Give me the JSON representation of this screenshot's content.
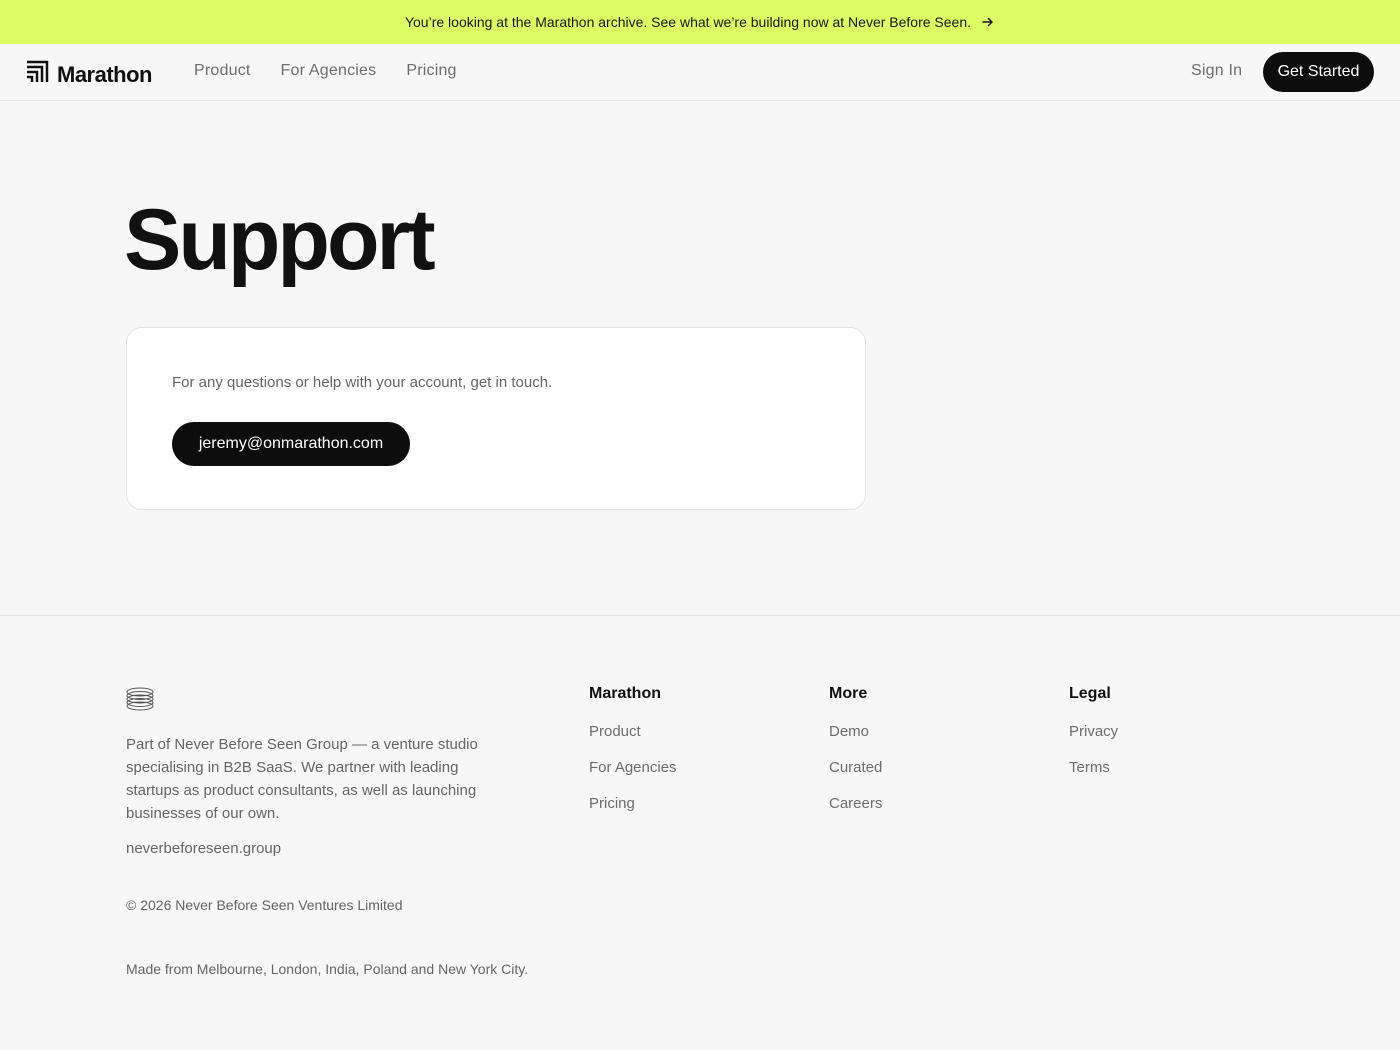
{
  "banner": {
    "text": "You’re looking at the Marathon archive. See what we’re building now at Never Before Seen.",
    "color": "#dbfc63"
  },
  "nav": {
    "brand": "Marathon",
    "links": [
      "Product",
      "For Agencies",
      "Pricing"
    ],
    "sign_in": "Sign In",
    "get_started": "Get Started"
  },
  "main": {
    "title": "Support",
    "card_text": "For any questions or help with your account, get in touch.",
    "email": "jeremy@onmarathon.com"
  },
  "footer": {
    "description": "Part of Never Before Seen Group — a venture studio specialising in B2B SaaS. We partner with leading startups as product consultants, as well as launching businesses of our own.",
    "site": "neverbeforeseen.group",
    "copyright": "© 2026 Never Before Seen Ventures Limited",
    "made_from": "Made from Melbourne, London, India, Poland and New York City.",
    "columns": [
      {
        "heading": "Marathon",
        "links": [
          "Product",
          "For Agencies",
          "Pricing"
        ]
      },
      {
        "heading": "More",
        "links": [
          "Demo",
          "Curated",
          "Careers"
        ]
      },
      {
        "heading": "Legal",
        "links": [
          "Privacy",
          "Terms"
        ]
      }
    ]
  }
}
